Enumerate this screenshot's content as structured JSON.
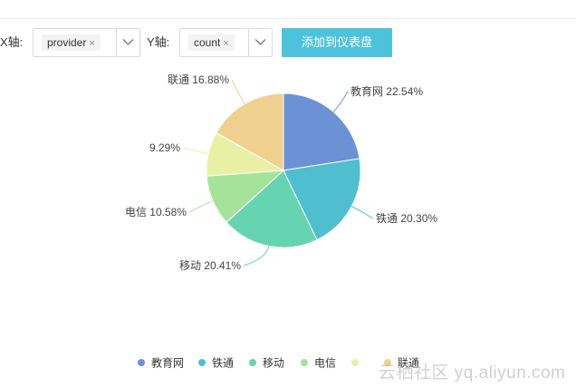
{
  "toolbar": {
    "x_label": "X轴:",
    "x_value": "provider",
    "y_label": "Y轴:",
    "y_value": "count",
    "remove_glyph": "×",
    "add_button": "添加到仪表盘"
  },
  "chart_data": {
    "type": "pie",
    "categories": [
      "教育网",
      "铁通",
      "移动",
      "电信",
      "",
      "联通"
    ],
    "values": [
      22.54,
      20.3,
      20.41,
      10.58,
      9.29,
      16.88
    ],
    "labels": [
      "教育网 22.54%",
      "铁通 20.30%",
      "移动 20.41%",
      "电信 10.58%",
      "9.29%",
      "联通 16.88%"
    ],
    "colors": [
      "#6b92d5",
      "#4fbfcf",
      "#66d4b0",
      "#a6e39a",
      "#e8f0a6",
      "#f0d08f"
    ],
    "legend_placement": "bottom"
  },
  "watermark": "云栖社区 yq.aliyun.com"
}
